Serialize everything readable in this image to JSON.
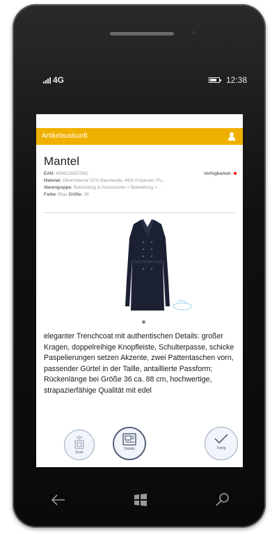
{
  "status": {
    "network": "4G",
    "time": "12:38",
    "battery_level": 0.75
  },
  "appbar": {
    "title": "Artikelauskunft"
  },
  "product": {
    "name": "Mantel",
    "ean_label": "EAN:",
    "ean_value": "4058216557892",
    "availability_label": "Verfügbarkeit:",
    "material_label": "Material:",
    "material_value": "Obermaterial 52% Baumwolle, 46% Polyester; Fu...",
    "group_label": "Warengruppe:",
    "group_value": "Bekleidung & Accessoires > Bekleidung >...",
    "color_label": "Farbe:",
    "color_value": "Blau",
    "size_label": "Größe:",
    "size_value": "38",
    "description": "eleganter Trenchcoat mit authentischen Details: großer Kragen, doppelreihige Knopfleiste, Schulterpasse, schicke Paspelierungen setzen Akzente, zwei Pattentaschen vorn, passender Gürtel in der Taille, antaillierte Passform; Rückenlänge bei Größe 36 ca. 88 cm, hochwertige, strapazierfähige Qualität mit edel"
  },
  "actions": {
    "scan": "Scan",
    "details": "Details",
    "done": "Fertig"
  },
  "colors": {
    "accent": "#f0b000",
    "availability": "#e00000"
  }
}
